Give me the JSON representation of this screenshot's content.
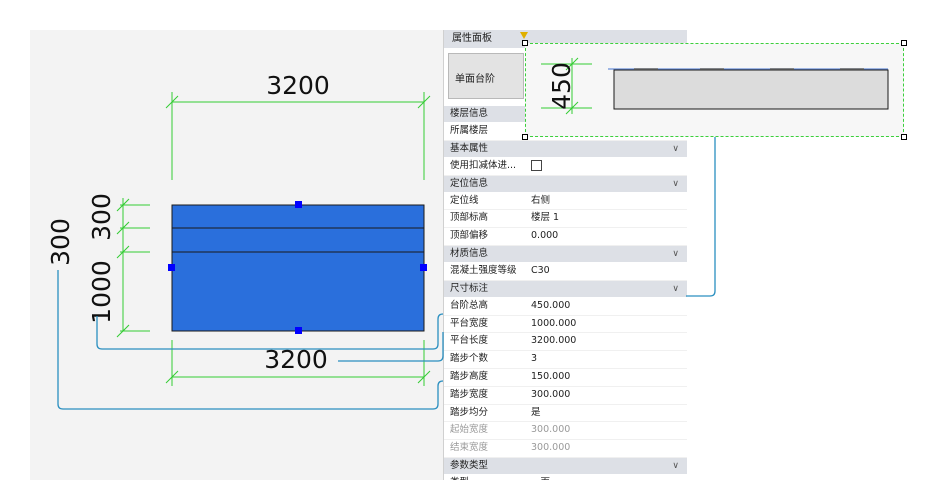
{
  "drawing": {
    "dim_top": "3200",
    "dim_bottom": "3200",
    "dim_step_height": "300",
    "dim_step_height_2": "300",
    "dim_platform": "1000",
    "dim_step_width": "300"
  },
  "preview": {
    "dim_height": "450"
  },
  "panel": {
    "title": "属性面板",
    "thumbnail_label": "单面台阶",
    "sections": [
      {
        "title": "楼层信息",
        "rows": [
          {
            "k": "所属楼层",
            "v": ""
          }
        ]
      },
      {
        "title": "基本属性",
        "rows": [
          {
            "k": "使用扣减体进...",
            "v": ""
          }
        ]
      },
      {
        "title": "定位信息",
        "rows": [
          {
            "k": "定位线",
            "v": "右侧"
          },
          {
            "k": "顶部标高",
            "v": "楼层 1"
          },
          {
            "k": "顶部偏移",
            "v": "0.000"
          }
        ]
      },
      {
        "title": "材质信息",
        "rows": [
          {
            "k": "混凝土强度等级",
            "v": "C30"
          }
        ]
      },
      {
        "title": "尺寸标注",
        "rows": [
          {
            "k": "台阶总高",
            "v": "450.000"
          },
          {
            "k": "平台宽度",
            "v": "1000.000"
          },
          {
            "k": "平台长度",
            "v": "3200.000"
          },
          {
            "k": "踏步个数",
            "v": "3"
          },
          {
            "k": "踏步高度",
            "v": "150.000"
          },
          {
            "k": "踏步宽度",
            "v": "300.000"
          },
          {
            "k": "踏步均分",
            "v": "是"
          },
          {
            "k": "起始宽度",
            "v": "300.000"
          },
          {
            "k": "结束宽度",
            "v": "300.000"
          }
        ]
      },
      {
        "title": "参数类型",
        "rows": [
          {
            "k": "类型",
            "v": "一面"
          }
        ]
      }
    ]
  },
  "colors": {
    "stair_fill": "#2a6fdc",
    "dimension_line": "#33cc33",
    "connector": "#2a8fc0",
    "grip": "#0000ff"
  }
}
